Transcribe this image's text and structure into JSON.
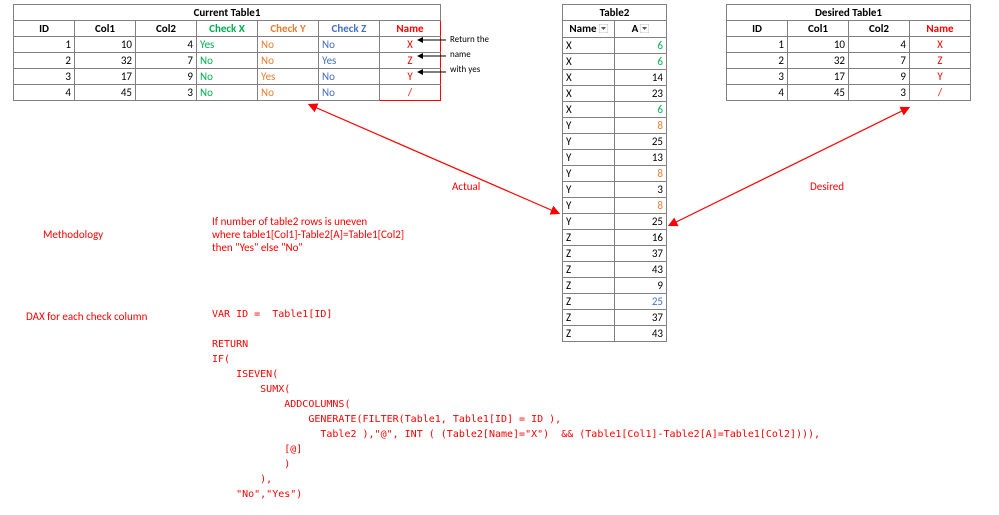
{
  "current": {
    "title": "Current Table1",
    "headers": [
      "ID",
      "Col1",
      "Col2",
      "Check X",
      "Check Y",
      "Check Z",
      "Name"
    ],
    "rows": [
      {
        "id": "1",
        "col1": "10",
        "col2": "4",
        "cx": "Yes",
        "cy": "No",
        "cz": "No",
        "name": "X"
      },
      {
        "id": "2",
        "col1": "32",
        "col2": "7",
        "cx": "No",
        "cy": "No",
        "cz": "Yes",
        "name": "Z"
      },
      {
        "id": "3",
        "col1": "17",
        "col2": "9",
        "cx": "No",
        "cy": "Yes",
        "cz": "No",
        "name": "Y"
      },
      {
        "id": "4",
        "col1": "45",
        "col2": "3",
        "cx": "No",
        "cy": "No",
        "cz": "No",
        "name": "/"
      }
    ]
  },
  "table2": {
    "title": "Table2",
    "headers": [
      "Name",
      "A"
    ],
    "rows": [
      {
        "n": "X",
        "a": "6",
        "c": "green"
      },
      {
        "n": "X",
        "a": "6",
        "c": "green"
      },
      {
        "n": "X",
        "a": "14",
        "c": ""
      },
      {
        "n": "X",
        "a": "23",
        "c": ""
      },
      {
        "n": "X",
        "a": "6",
        "c": "green"
      },
      {
        "n": "Y",
        "a": "8",
        "c": "orange"
      },
      {
        "n": "Y",
        "a": "25",
        "c": ""
      },
      {
        "n": "Y",
        "a": "13",
        "c": ""
      },
      {
        "n": "Y",
        "a": "8",
        "c": "orange"
      },
      {
        "n": "Y",
        "a": "3",
        "c": ""
      },
      {
        "n": "Y",
        "a": "8",
        "c": "orange"
      },
      {
        "n": "Y",
        "a": "25",
        "c": ""
      },
      {
        "n": "Z",
        "a": "16",
        "c": ""
      },
      {
        "n": "Z",
        "a": "37",
        "c": ""
      },
      {
        "n": "Z",
        "a": "43",
        "c": ""
      },
      {
        "n": "Z",
        "a": "9",
        "c": ""
      },
      {
        "n": "Z",
        "a": "25",
        "c": "blue"
      },
      {
        "n": "Z",
        "a": "37",
        "c": ""
      },
      {
        "n": "Z",
        "a": "43",
        "c": ""
      }
    ]
  },
  "desired": {
    "title": "Desired Table1",
    "headers": [
      "ID",
      "Col1",
      "Col2",
      "Name"
    ],
    "rows": [
      {
        "id": "1",
        "col1": "10",
        "col2": "4",
        "name": "X"
      },
      {
        "id": "2",
        "col1": "32",
        "col2": "7",
        "name": "Z"
      },
      {
        "id": "3",
        "col1": "17",
        "col2": "9",
        "name": "Y"
      },
      {
        "id": "4",
        "col1": "45",
        "col2": "3",
        "name": "/"
      }
    ]
  },
  "annotations": {
    "return_line1": "Return the",
    "return_line2": "name",
    "return_line3": "with yes",
    "actual": "Actual",
    "desired_label": "Desired",
    "methodology_label": "Methodology",
    "methodology_text1": "If number of table2 rows is uneven",
    "methodology_text2": "where table1[Col1]-Table2[A]=Table1[Col2]",
    "methodology_text3": "then \"Yes\" else \"No\"",
    "dax_label": "DAX for each check column"
  },
  "dax_code": "VAR ID =  Table1[ID]\n\nRETURN\nIF(\n    ISEVEN(\n        SUMX(\n            ADDCOLUMNS(\n                GENERATE(FILTER(Table1, Table1[ID] = ID ),\n                  Table2 ),\"@\", INT ( (Table2[Name]=\"X\")  && (Table1[Col1]-Table2[A]=Table1[Col2]))),\n            [@]\n            )\n        ),\n    \"No\",\"Yes\")"
}
